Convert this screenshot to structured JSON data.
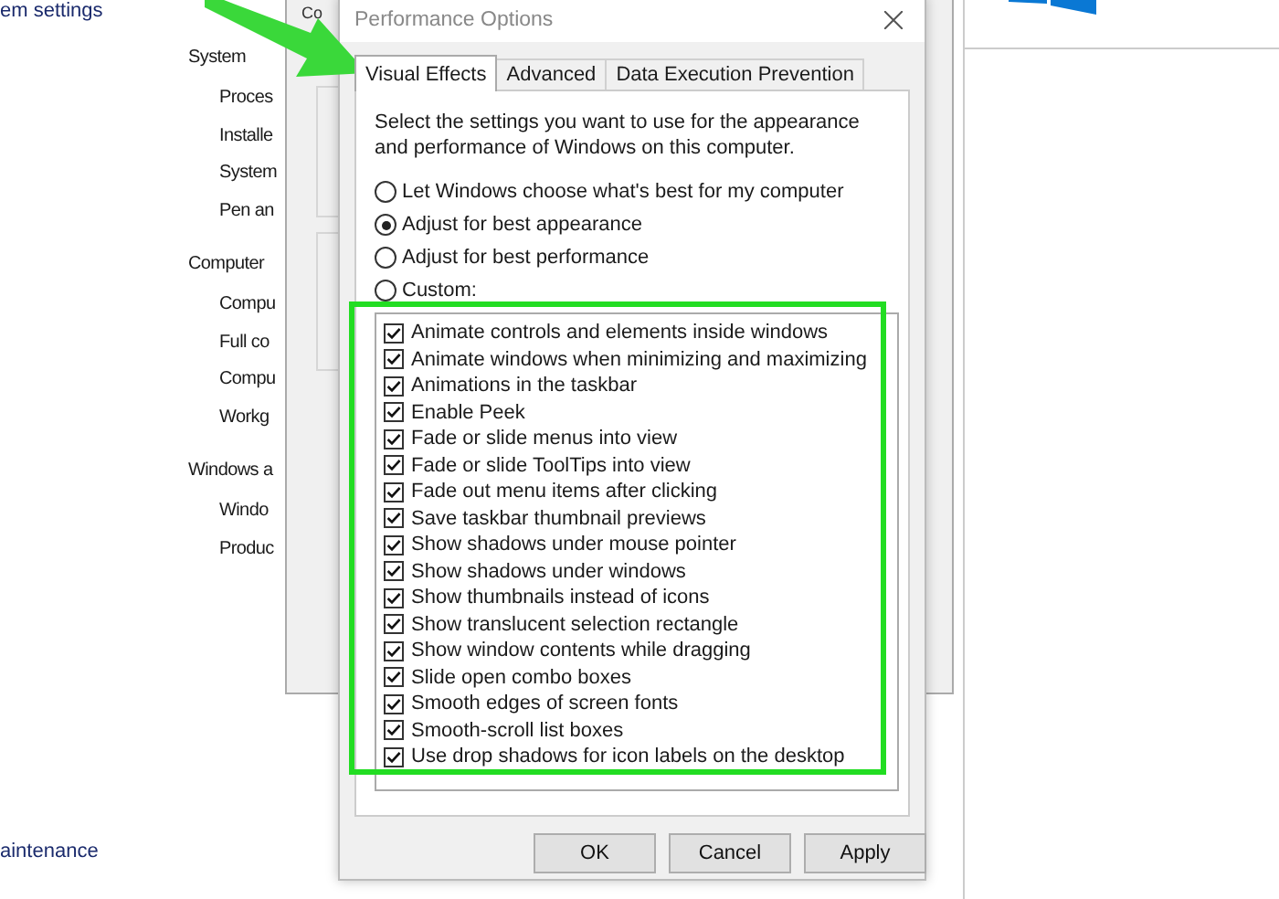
{
  "background": {
    "link_top": "em settings",
    "sections": [
      {
        "heading": "System",
        "items": [
          "Proces",
          "Installe",
          "System",
          "Pen an"
        ]
      },
      {
        "heading": "Computer",
        "items": [
          "Compu",
          "Full co",
          "Compu",
          "Workg"
        ]
      },
      {
        "heading": "Windows a",
        "items": [
          "Windo",
          "Produc"
        ]
      }
    ],
    "link_bottom": "aintenance"
  },
  "back_window": {
    "tab": "Co"
  },
  "dialog": {
    "title": "Performance Options",
    "tabs": [
      {
        "label": "Visual Effects",
        "selected": true
      },
      {
        "label": "Advanced",
        "selected": false
      },
      {
        "label": "Data Execution Prevention",
        "selected": false
      }
    ],
    "description": "Select the settings you want to use for the appearance and performance of Windows on this computer.",
    "options": [
      {
        "label": "Let Windows choose what's best for my computer",
        "selected": false
      },
      {
        "label": "Adjust for best appearance",
        "selected": true
      },
      {
        "label": "Adjust for best performance",
        "selected": false
      },
      {
        "label": "Custom:",
        "selected": false
      }
    ],
    "effects": [
      {
        "label": "Animate controls and elements inside windows",
        "checked": true
      },
      {
        "label": "Animate windows when minimizing and maximizing",
        "checked": true
      },
      {
        "label": "Animations in the taskbar",
        "checked": true
      },
      {
        "label": "Enable Peek",
        "checked": true
      },
      {
        "label": "Fade or slide menus into view",
        "checked": true
      },
      {
        "label": "Fade or slide ToolTips into view",
        "checked": true
      },
      {
        "label": "Fade out menu items after clicking",
        "checked": true
      },
      {
        "label": "Save taskbar thumbnail previews",
        "checked": true
      },
      {
        "label": "Show shadows under mouse pointer",
        "checked": true
      },
      {
        "label": "Show shadows under windows",
        "checked": true
      },
      {
        "label": "Show thumbnails instead of icons",
        "checked": true
      },
      {
        "label": "Show translucent selection rectangle",
        "checked": true
      },
      {
        "label": "Show window contents while dragging",
        "checked": true
      },
      {
        "label": "Slide open combo boxes",
        "checked": true
      },
      {
        "label": "Smooth edges of screen fonts",
        "checked": true
      },
      {
        "label": "Smooth-scroll list boxes",
        "checked": true
      },
      {
        "label": "Use drop shadows for icon labels on the desktop",
        "checked": true
      }
    ],
    "buttons": [
      "OK",
      "Cancel",
      "Apply"
    ]
  }
}
